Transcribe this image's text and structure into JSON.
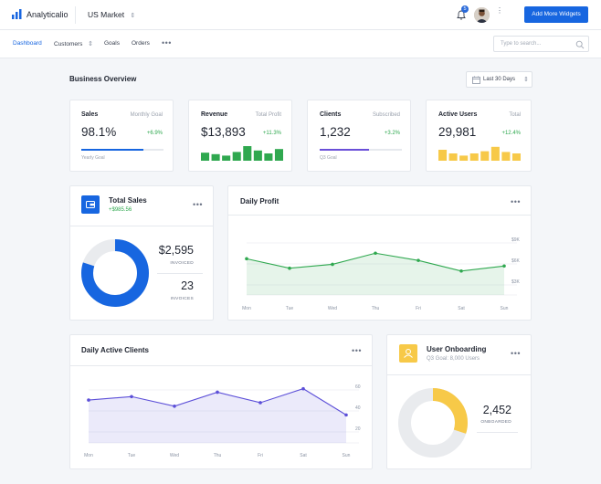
{
  "header": {
    "app_name": "Analyticalio",
    "market": "US Market",
    "notification_count": "5",
    "add_button": "Add More Widgets"
  },
  "nav": {
    "items": [
      "Dashboard",
      "Customers",
      "Goals",
      "Orders"
    ],
    "search_placeholder": "Type to search..."
  },
  "overview": {
    "title": "Business Overview",
    "range": "Last 30 Days"
  },
  "kpis": [
    {
      "title": "Sales",
      "subtitle": "Monthly Goal",
      "value": "98.1%",
      "delta": "+6.9%",
      "goal_label": "Yearly Goal",
      "progress": 0.75,
      "color": "#1766e0"
    },
    {
      "title": "Revenue",
      "subtitle": "Total Profit",
      "value": "$13,893",
      "delta": "+11.3%",
      "bars": [
        0.55,
        0.45,
        0.35,
        0.6,
        1.0,
        0.7,
        0.5,
        0.8
      ],
      "color": "#2fa84f"
    },
    {
      "title": "Clients",
      "subtitle": "Subscribed",
      "value": "1,232",
      "delta": "+3.2%",
      "goal_label": "Q3 Goal",
      "progress": 0.6,
      "color": "#6a4fd8"
    },
    {
      "title": "Active Users",
      "subtitle": "Total",
      "value": "29,981",
      "delta": "+12.4%",
      "bars": [
        0.75,
        0.5,
        0.35,
        0.5,
        0.65,
        0.95,
        0.6,
        0.5
      ],
      "color": "#f7c948"
    }
  ],
  "total_sales": {
    "title": "Total Sales",
    "delta": "+$985.56",
    "value1": "$2,595",
    "label1": "INVOICED",
    "value2": "23",
    "label2": "INVOICES",
    "share": 0.8
  },
  "onboarding": {
    "title": "User Onboarding",
    "subtitle": "Q3 Goal: 8,000 Users",
    "value": "2,452",
    "label": "ONBOARDED",
    "share": 0.3
  },
  "chart_data": [
    {
      "type": "area",
      "title": "Daily Profit",
      "categories": [
        "Mon",
        "Tue",
        "Wed",
        "Thu",
        "Fri",
        "Sat",
        "Sun"
      ],
      "values": [
        6.5,
        4.8,
        5.5,
        7.5,
        6.2,
        4.3,
        5.2
      ],
      "yticks": [
        "$3K",
        "$6K",
        "$9K"
      ],
      "ylim": [
        0,
        10
      ],
      "color": "#2fa84f"
    },
    {
      "type": "area",
      "title": "Daily Active Clients",
      "categories": [
        "Mon",
        "Tue",
        "Wed",
        "Thu",
        "Fri",
        "Sat",
        "Sun"
      ],
      "values": [
        49,
        53,
        42,
        58,
        46,
        62,
        32
      ],
      "yticks": [
        "20",
        "40",
        "60"
      ],
      "ylim": [
        0,
        70
      ],
      "color": "#5c4fd8"
    }
  ]
}
